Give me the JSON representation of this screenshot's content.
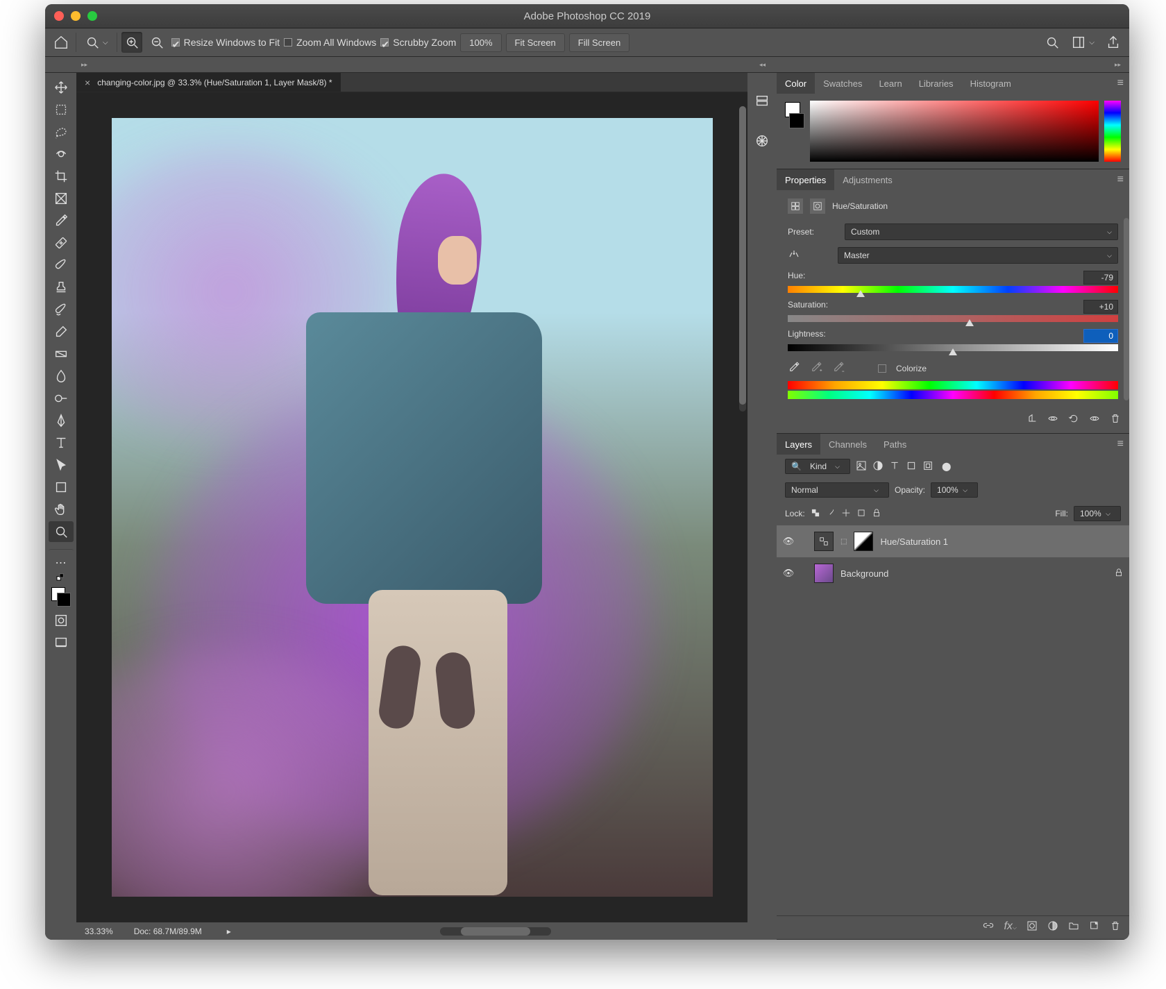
{
  "app": {
    "title": "Adobe Photoshop CC 2019"
  },
  "traffic": {
    "close": "close",
    "min": "minimize",
    "max": "maximize"
  },
  "optbar": {
    "resize": "Resize Windows to Fit",
    "zoomall": "Zoom All Windows",
    "scrubby": "Scrubby Zoom",
    "zoom": "100%",
    "fit": "Fit Screen",
    "fill": "Fill Screen"
  },
  "tab": {
    "name": "changing-color.jpg @ 33.3% (Hue/Saturation 1, Layer Mask/8) *"
  },
  "status": {
    "zoom": "33.33%",
    "doc": "Doc: 68.7M/89.9M"
  },
  "panelTabs": {
    "top": [
      "Color",
      "Swatches",
      "Learn",
      "Libraries",
      "Histogram"
    ],
    "mid": [
      "Properties",
      "Adjustments"
    ],
    "bot": [
      "Layers",
      "Channels",
      "Paths"
    ]
  },
  "properties": {
    "title": "Hue/Saturation",
    "presetLabel": "Preset:",
    "preset": "Custom",
    "channel": "Master",
    "hueLabel": "Hue:",
    "hue": "-79",
    "satLabel": "Saturation:",
    "sat": "+10",
    "lightLabel": "Lightness:",
    "light": "0",
    "colorize": "Colorize"
  },
  "layers": {
    "kind": "Kind",
    "blend": "Normal",
    "opacityLabel": "Opacity:",
    "opacity": "100%",
    "lockLabel": "Lock:",
    "fillLabel": "Fill:",
    "fill": "100%",
    "layer1": "Hue/Saturation 1",
    "layer2": "Background"
  }
}
